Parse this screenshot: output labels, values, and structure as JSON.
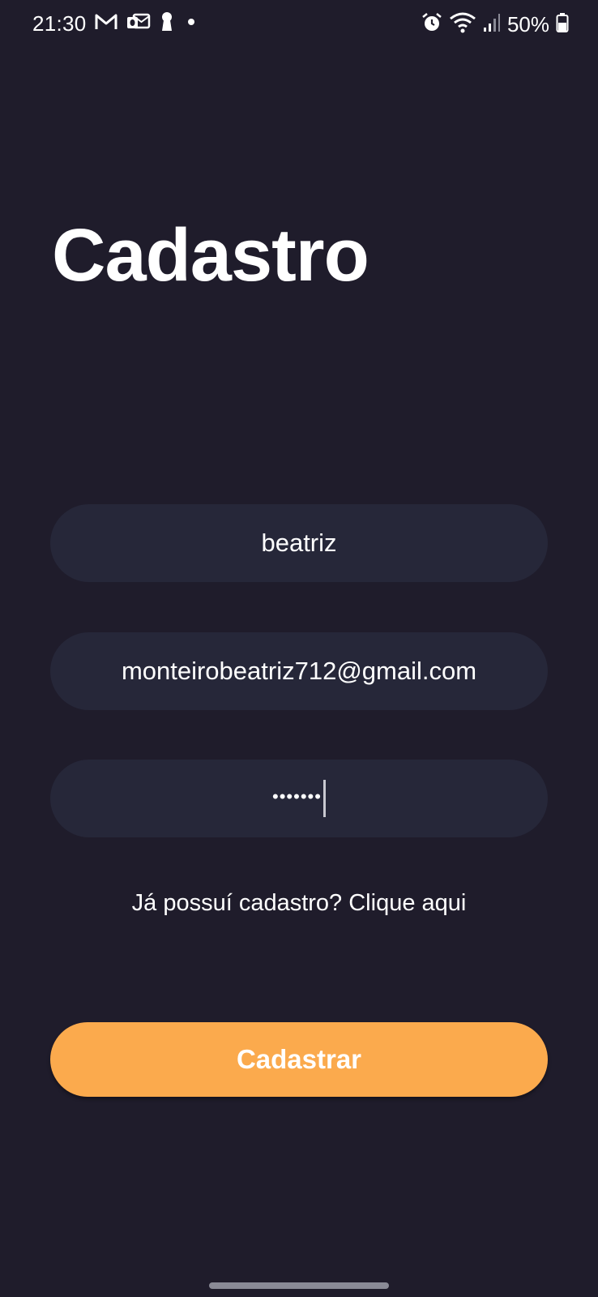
{
  "status_bar": {
    "time": "21:30",
    "notification_icons": [
      "gmail-icon",
      "outlook-icon",
      "keyhole-icon",
      "dot-icon"
    ],
    "system_icons": [
      "alarm-icon",
      "wifi-icon",
      "signal-icon",
      "battery-icon"
    ],
    "battery_level": "50%"
  },
  "screen": {
    "title": "Cadastro"
  },
  "form": {
    "name_value": "beatriz",
    "email_value": "monteirobeatriz712@gmail.com",
    "password_mask": "•••••••"
  },
  "login_link": "Já possuí cadastro? Clique aqui",
  "submit_button": "Cadastrar",
  "colors": {
    "background": "#1f1c2b",
    "field_background": "#262739",
    "accent": "#fbaa4d"
  }
}
